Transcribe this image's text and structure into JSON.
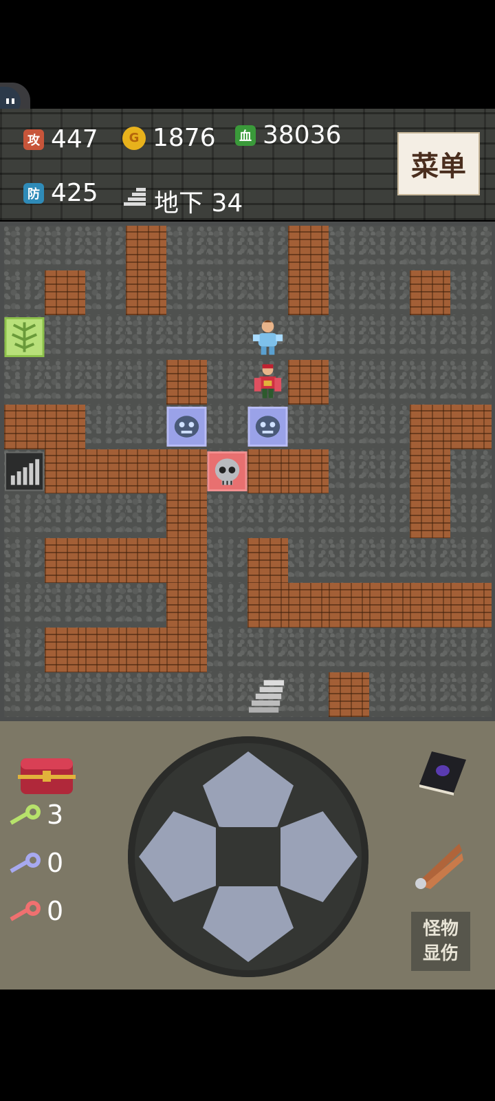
{
  "hud": {
    "attack_label": "攻",
    "attack": "447",
    "gold_label": "G",
    "gold": "1876",
    "hp_label": "血",
    "hp": "38036",
    "defense_label": "防",
    "defense": "425",
    "floor": "地下 34",
    "menu_label": "菜单"
  },
  "keys": {
    "yellow": "3",
    "blue": "0",
    "red": "0"
  },
  "controls": {
    "monster_damage_label_line1": "怪物",
    "monster_damage_label_line2": "显伤"
  },
  "colors": {
    "wall": "#a35f36",
    "floor": "#4f514f",
    "control_panel": "#7d7866",
    "dpad_arrow": "#9aa2b7"
  },
  "map": {
    "rows": [
      "...#...#....",
      ".#.#...#..#.",
      "G.....H.....",
      "....#.P#....",
      "##..M.M...##",
      "S####X##..#.",
      "....#.....#.",
      ".####.#.....",
      "....#.######",
      ".####.......",
      "......U.#..."
    ],
    "legend": {
      "#": "brown-brick-wall",
      ".": "stone-floor",
      "G": "green-vine-door",
      "H": "blue-armored-hero",
      "P": "red-armored-guard",
      "M": "blue-gargoyle-monster",
      "X": "skull-monster",
      "S": "stairs-up",
      "U": "stairs-down"
    }
  }
}
